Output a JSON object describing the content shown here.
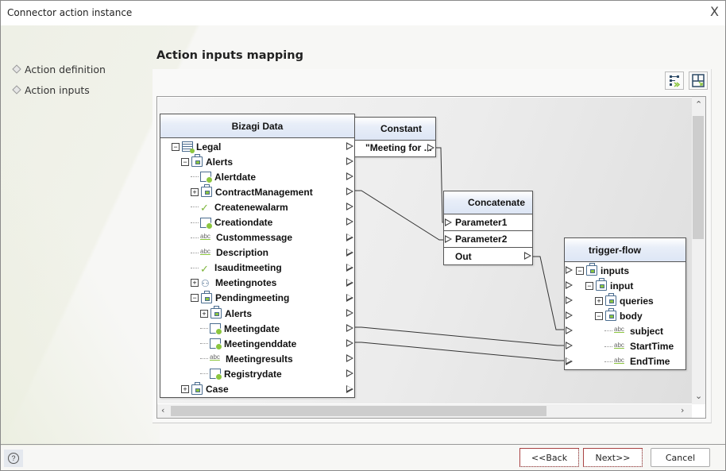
{
  "window": {
    "title": "Connector action instance",
    "close_label": "X"
  },
  "nav": {
    "items": [
      {
        "label": "Action definition"
      },
      {
        "label": "Action inputs"
      }
    ]
  },
  "page": {
    "heading": "Action inputs mapping"
  },
  "toolbar": {
    "auto_map_icon": "auto-map-icon",
    "layout_icon": "layout-icon"
  },
  "source": {
    "title": "Bizagi Data",
    "rows": [
      {
        "label": "Legal",
        "icon": "table",
        "expander": "minus",
        "level": 0
      },
      {
        "label": "Alerts",
        "icon": "entity",
        "expander": "minus",
        "level": 1
      },
      {
        "label": "Alertdate",
        "icon": "date",
        "expander": "",
        "level": 2
      },
      {
        "label": "ContractManagement",
        "icon": "entity",
        "expander": "plus",
        "level": 2
      },
      {
        "label": "Createnewalarm",
        "icon": "check",
        "expander": "",
        "level": 2
      },
      {
        "label": "Creationdate",
        "icon": "date",
        "expander": "",
        "level": 2
      },
      {
        "label": "Custommessage",
        "icon": "abc",
        "expander": "",
        "level": 2
      },
      {
        "label": "Description",
        "icon": "abc",
        "expander": "",
        "level": 2
      },
      {
        "label": "Isauditmeeting",
        "icon": "check",
        "expander": "",
        "level": 2
      },
      {
        "label": "Meetingnotes",
        "icon": "relation",
        "expander": "plus",
        "level": 2
      },
      {
        "label": "Pendingmeeting",
        "icon": "entity",
        "expander": "minus",
        "level": 2
      },
      {
        "label": "Alerts",
        "icon": "entity",
        "expander": "plus",
        "level": 3
      },
      {
        "label": "Meetingdate",
        "icon": "date",
        "expander": "",
        "level": 3
      },
      {
        "label": "Meetingenddate",
        "icon": "date",
        "expander": "",
        "level": 3
      },
      {
        "label": "Meetingresults",
        "icon": "abc",
        "expander": "",
        "level": 3
      },
      {
        "label": "Registrydate",
        "icon": "date",
        "expander": "",
        "level": 3
      },
      {
        "label": "Case",
        "icon": "entity",
        "expander": "plus",
        "level": 1
      }
    ]
  },
  "constant": {
    "title": "Constant",
    "value": "\"Meeting for ..."
  },
  "concatenate": {
    "title": "Concatenate",
    "rows": [
      {
        "label": "Parameter1"
      },
      {
        "label": "Parameter2"
      },
      {
        "label": "Out"
      }
    ]
  },
  "target": {
    "title": "trigger-flow",
    "rows": [
      {
        "label": "inputs",
        "icon": "entity",
        "expander": "minus",
        "level": 0
      },
      {
        "label": "input",
        "icon": "entity",
        "expander": "minus",
        "level": 1
      },
      {
        "label": "queries",
        "icon": "entity",
        "expander": "plus",
        "level": 2
      },
      {
        "label": "body",
        "icon": "entity",
        "expander": "minus",
        "level": 2
      },
      {
        "label": "subject",
        "icon": "abc",
        "expander": "",
        "level": 3
      },
      {
        "label": "StartTime",
        "icon": "abc",
        "expander": "",
        "level": 3
      },
      {
        "label": "EndTime",
        "icon": "abc",
        "expander": "",
        "level": 3
      }
    ]
  },
  "mappings": [
    {
      "from": "constant.value",
      "to": "concatenate.Parameter1"
    },
    {
      "from": "source.ContractManagement",
      "to": "concatenate.Parameter2"
    },
    {
      "from": "concatenate.Out",
      "to": "target.subject"
    },
    {
      "from": "source.Meetingdate",
      "to": "target.StartTime"
    },
    {
      "from": "source.Meetingenddate",
      "to": "target.EndTime"
    }
  ],
  "footer": {
    "help_label": "?",
    "back_label": "<<Back",
    "next_label": "Next>>",
    "cancel_label": "Cancel"
  }
}
